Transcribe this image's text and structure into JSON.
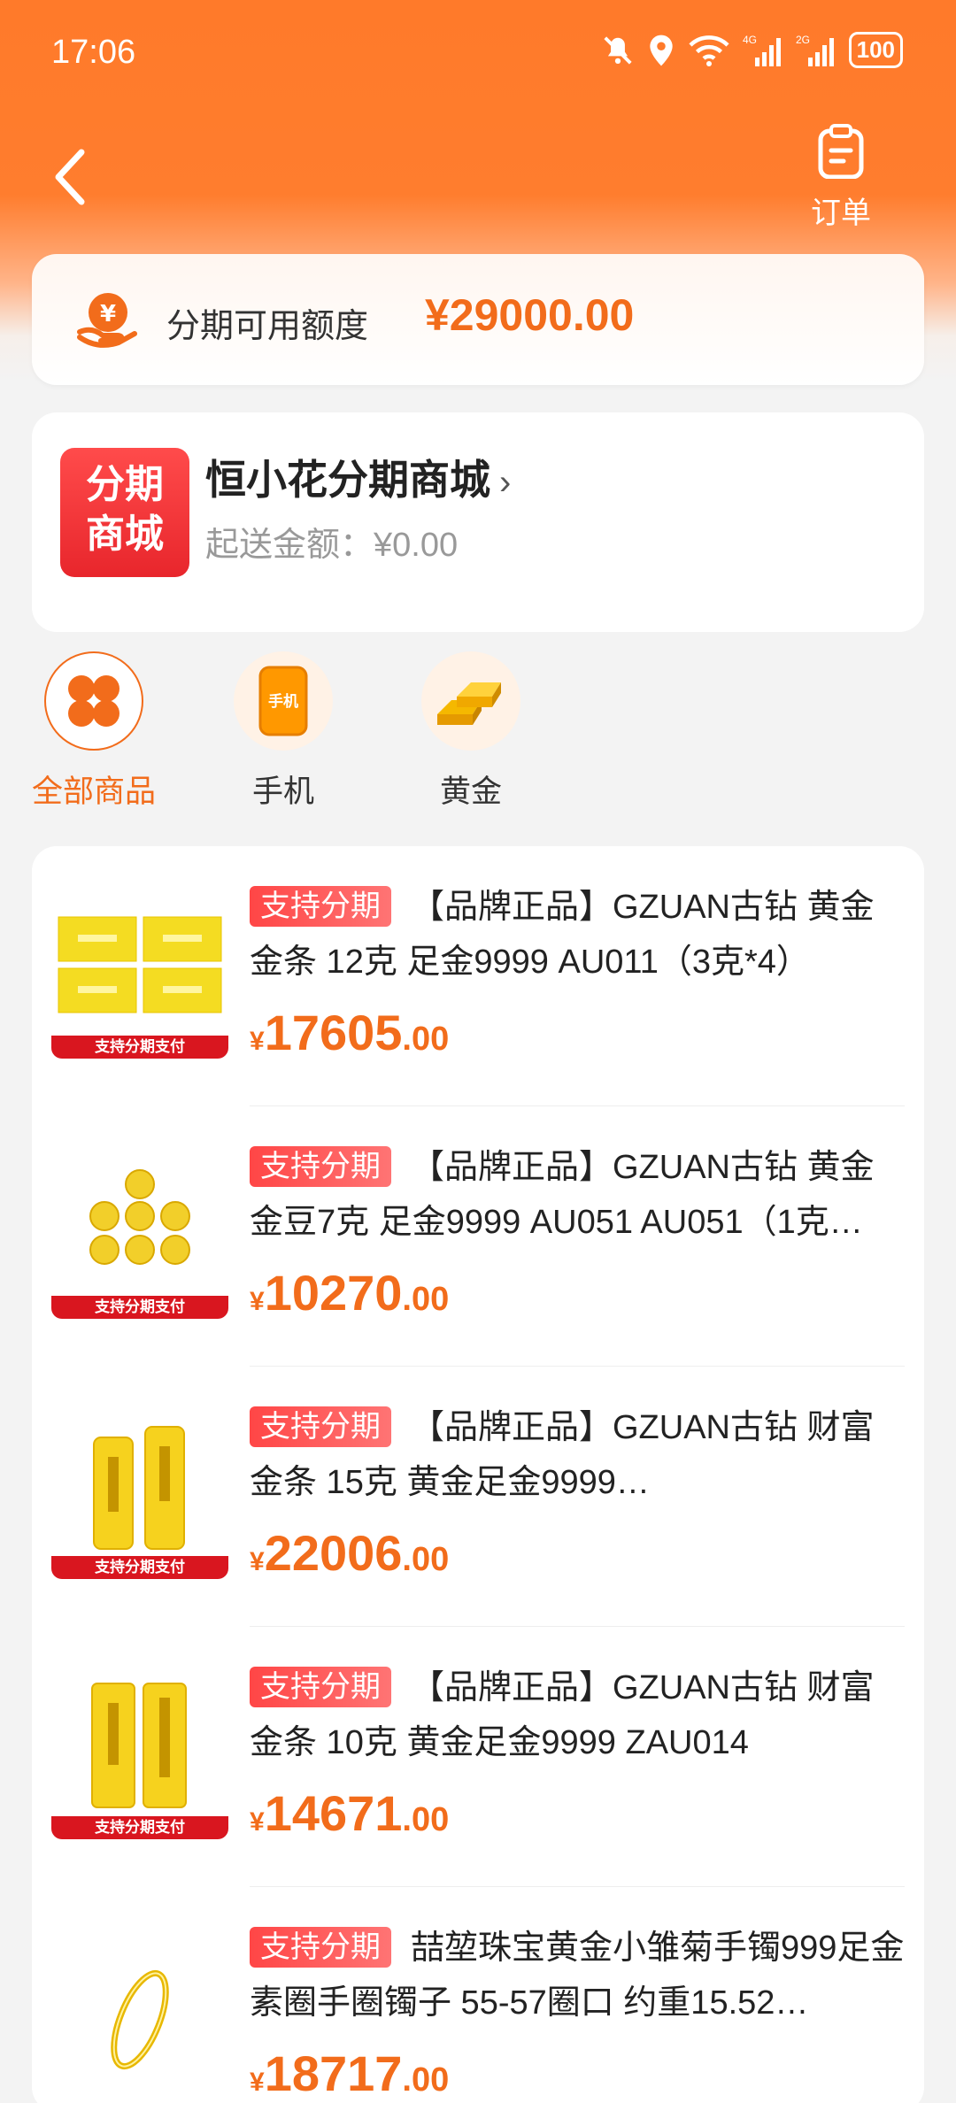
{
  "status_bar": {
    "time": "17:06",
    "battery": "100",
    "net1": "4G",
    "net2": "2G"
  },
  "header": {
    "order_label": "订单"
  },
  "credit": {
    "label": "分期可用额度",
    "amount": "¥29000.00"
  },
  "store": {
    "badge_line1": "分期",
    "badge_line2": "商城",
    "name": "恒小花分期商城",
    "min_label": "起送金额：",
    "min_value": "¥0.00"
  },
  "categories": [
    {
      "label": "全部商品",
      "icon": "clover-icon",
      "active": true
    },
    {
      "label": "手机",
      "icon": "phone-icon",
      "icon_text": "手机"
    },
    {
      "label": "黄金",
      "icon": "gold-bar-icon"
    }
  ],
  "products": [
    {
      "tag": "支持分期",
      "title": "【品牌正品】GZUAN古钻 黄金金条 12克 足金9999 AU011（3克*4）",
      "currency": "¥",
      "price_int": "17605",
      "price_dec": ".00",
      "thumb_label": "支持分期支付"
    },
    {
      "tag": "支持分期",
      "title": "【品牌正品】GZUAN古钻 黄金金豆7克 足金9999 AU051 AU051（1克…",
      "currency": "¥",
      "price_int": "10270",
      "price_dec": ".00",
      "thumb_label": "支持分期支付"
    },
    {
      "tag": "支持分期",
      "title": "【品牌正品】GZUAN古钻 财富金条 15克 黄金足金9999…",
      "currency": "¥",
      "price_int": "22006",
      "price_dec": ".00",
      "thumb_label": "支持分期支付"
    },
    {
      "tag": "支持分期",
      "title": "【品牌正品】GZUAN古钻 财富金条 10克 黄金足金9999 ZAU014",
      "currency": "¥",
      "price_int": "14671",
      "price_dec": ".00",
      "thumb_label": "支持分期支付"
    },
    {
      "tag": "支持分期",
      "title": "喆堃珠宝黄金小雏菊手镯999足金素圈手圈镯子 55-57圈口 约重15.52…",
      "currency": "¥",
      "price_int": "18717",
      "price_dec": ".00"
    }
  ],
  "colors": {
    "brand": "#ff7a2a",
    "price": "#f26c1b",
    "tag": "#ff4646"
  }
}
